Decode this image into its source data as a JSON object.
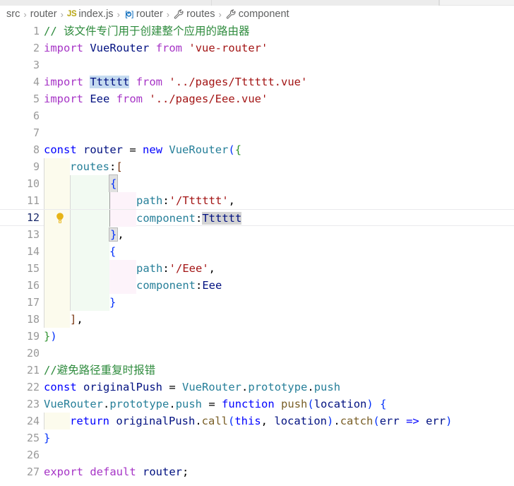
{
  "window": {
    "app": "Visual Studio Code",
    "theme": "Light+"
  },
  "tabbar": {
    "segments": [
      {
        "name": "tab-1",
        "active": false
      },
      {
        "name": "tab-2",
        "active": false
      },
      {
        "name": "tab-3",
        "active": false
      },
      {
        "name": "tab-4-active",
        "active": true
      },
      {
        "name": "tab-5",
        "active": false
      }
    ]
  },
  "breadcrumb": {
    "items": [
      {
        "label": "src",
        "icon": "none"
      },
      {
        "label": "router",
        "icon": "none"
      },
      {
        "label": "index.js",
        "icon": "js-file-icon"
      },
      {
        "label": "router",
        "icon": "variable-icon"
      },
      {
        "label": "routes",
        "icon": "property-wrench-icon"
      },
      {
        "label": "component",
        "icon": "property-wrench-icon"
      }
    ],
    "separator": "›"
  },
  "editor": {
    "file": "index.js",
    "language": "JavaScript",
    "active_line": 12,
    "code_action_hint": "lightbulb-icon",
    "total_lines": 27,
    "lines": [
      {
        "n": 1,
        "text": "// 该文件专门用于创建整个应用的路由器"
      },
      {
        "n": 2,
        "text": "import VueRouter from 'vue-router'"
      },
      {
        "n": 3,
        "text": ""
      },
      {
        "n": 4,
        "text": "import Tttttt from '../pages/Tttttt.vue'"
      },
      {
        "n": 5,
        "text": "import Eee from '../pages/Eee.vue'"
      },
      {
        "n": 6,
        "text": ""
      },
      {
        "n": 7,
        "text": ""
      },
      {
        "n": 8,
        "text": "const router = new VueRouter({"
      },
      {
        "n": 9,
        "text": "    routes:["
      },
      {
        "n": 10,
        "text": "        {"
      },
      {
        "n": 11,
        "text": "            path:'/Tttttt',"
      },
      {
        "n": 12,
        "text": "            component:Tttttt"
      },
      {
        "n": 13,
        "text": "        },"
      },
      {
        "n": 14,
        "text": "        {"
      },
      {
        "n": 15,
        "text": "            path:'/Eee',"
      },
      {
        "n": 16,
        "text": "            component:Eee"
      },
      {
        "n": 17,
        "text": "        }"
      },
      {
        "n": 18,
        "text": "    ],"
      },
      {
        "n": 19,
        "text": "})"
      },
      {
        "n": 20,
        "text": ""
      },
      {
        "n": 21,
        "text": "//避免路径重复时报错"
      },
      {
        "n": 22,
        "text": "const originalPush = VueRouter.prototype.push"
      },
      {
        "n": 23,
        "text": "VueRouter.prototype.push = function push(location) {"
      },
      {
        "n": 24,
        "text": "    return originalPush.call(this, location).catch(err => err)"
      },
      {
        "n": 25,
        "text": "}"
      },
      {
        "n": 26,
        "text": ""
      },
      {
        "n": 27,
        "text": "export default router;"
      }
    ],
    "highlights": [
      {
        "line": 4,
        "token": "Tttttt",
        "style": "selection-blue"
      },
      {
        "line": 12,
        "token": "Tttttt",
        "style": "word-occurrence-gray"
      },
      {
        "line": 10,
        "token": "{",
        "style": "bracket-match"
      },
      {
        "line": 13,
        "token": "}",
        "style": "bracket-match"
      }
    ]
  },
  "colors": {
    "background": "#ffffff",
    "line_number": "#9a9a9a",
    "line_number_active": "#1a2a6b",
    "comment": "#2e8b3d",
    "keyword": "#a634c6",
    "control": "#0000ff",
    "variable": "#001080",
    "type": "#267f99",
    "string": "#a31515",
    "function": "#795e26",
    "bracket_level1": "#0431fa",
    "bracket_level2": "#319331",
    "bracket_level3": "#7b3814",
    "indent_band_yellow": "#fcfbed",
    "indent_band_green": "#f2faf2",
    "indent_band_pink": "#fdf3fa",
    "selection_blue": "#c5dbf0",
    "occurrence_gray": "#d4d4d4",
    "lightbulb": "#e7b416"
  }
}
